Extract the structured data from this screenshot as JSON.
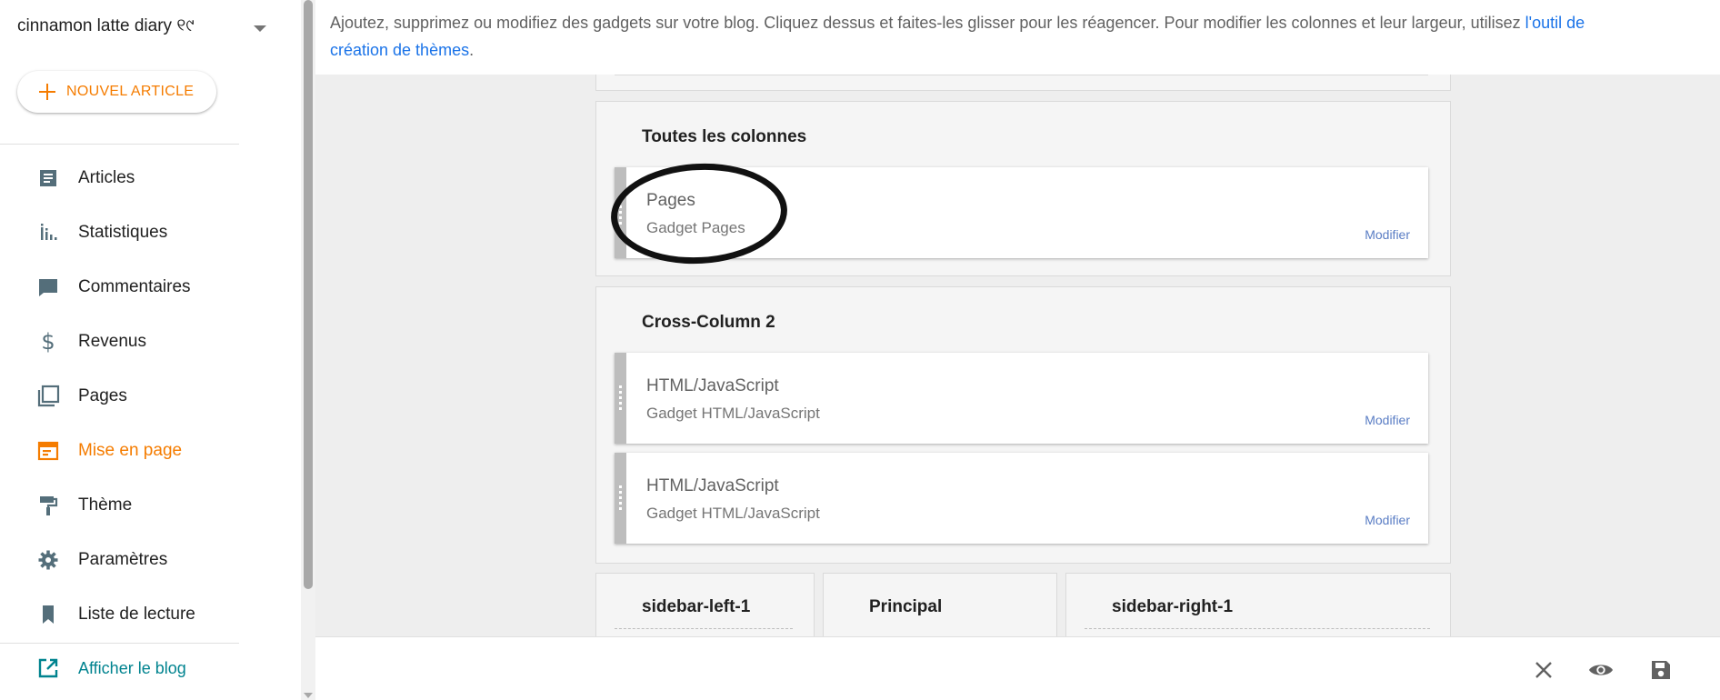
{
  "sidebar": {
    "blog_title": "cinnamon latte diary ୧୯",
    "new_post_label": "NOUVEL ARTICLE",
    "nav": [
      {
        "label": "Articles",
        "icon": "articles-icon"
      },
      {
        "label": "Statistiques",
        "icon": "stats-icon"
      },
      {
        "label": "Commentaires",
        "icon": "comment-icon"
      },
      {
        "label": "Revenus",
        "icon": "dollar-icon"
      },
      {
        "label": "Pages",
        "icon": "pages-icon"
      },
      {
        "label": "Mise en page",
        "icon": "layout-icon",
        "active": true
      },
      {
        "label": "Thème",
        "icon": "paint-roller-icon"
      },
      {
        "label": "Paramètres",
        "icon": "gear-icon"
      },
      {
        "label": "Liste de lecture",
        "icon": "bookmark-icon"
      }
    ],
    "view_blog_label": "Afficher le blog"
  },
  "info": {
    "text": "Ajoutez, supprimez ou modifiez des gadgets sur votre blog. Cliquez dessus et faites-les glisser pour les réagencer. Pour modifier les colonnes et leur largeur, utilisez ",
    "link_part1": "l'outil de",
    "link_part2": "création de thèmes",
    "end": "."
  },
  "sections": {
    "all_columns": {
      "title": "Toutes les colonnes",
      "widgets": [
        {
          "title": "Pages",
          "subtitle": "Gadget Pages",
          "edit": "Modifier"
        }
      ]
    },
    "cross_column_2": {
      "title": "Cross-Column 2",
      "widgets": [
        {
          "title": "HTML/JavaScript",
          "subtitle": "Gadget HTML/JavaScript",
          "edit": "Modifier"
        },
        {
          "title": "HTML/JavaScript",
          "subtitle": "Gadget HTML/JavaScript",
          "edit": "Modifier"
        }
      ]
    },
    "sidebar_left": {
      "title": "sidebar-left-1"
    },
    "main": {
      "title": "Principal"
    },
    "sidebar_right": {
      "title": "sidebar-right-1"
    }
  },
  "colors": {
    "accent": "#f57c00",
    "link": "#1a73e8",
    "teal": "#00838f"
  }
}
